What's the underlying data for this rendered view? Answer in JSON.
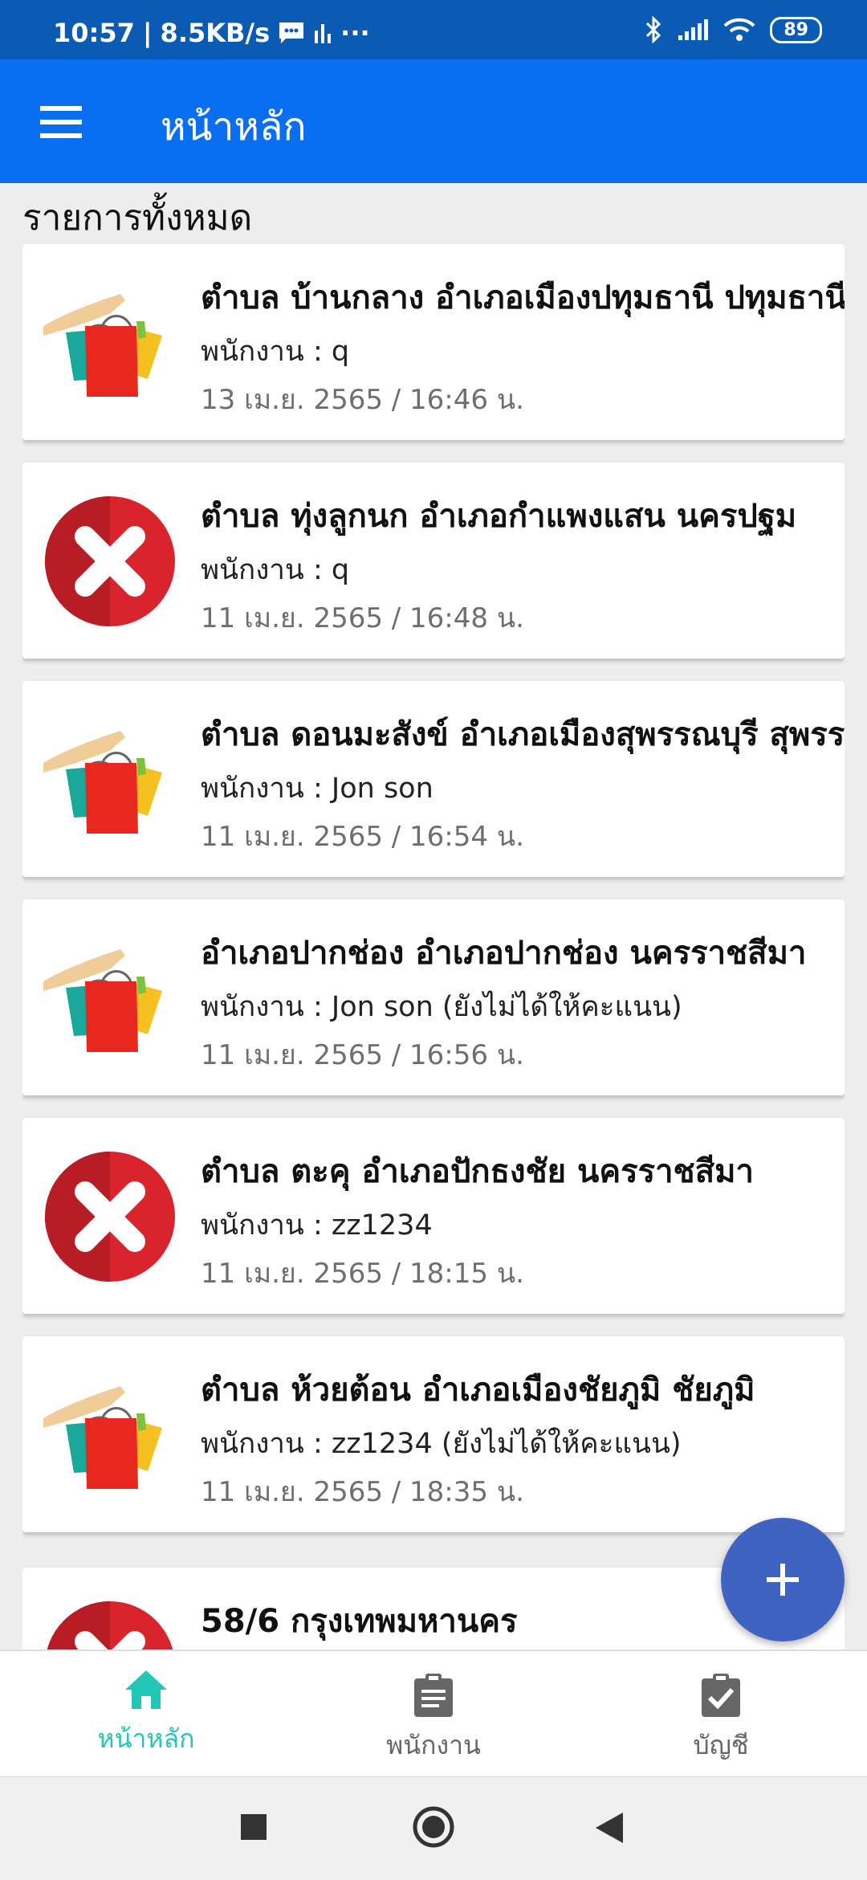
{
  "status_bar": {
    "time": "10:57",
    "speed": "8.5KB/s",
    "more": "···",
    "battery": "89"
  },
  "app_bar": {
    "title": "หน้าหลัก"
  },
  "section_title": "รายการทั้งหมด",
  "items": [
    {
      "title": "ตำบล บ้านกลาง อำเภอเมืองปทุมธานี ปทุมธานี",
      "staff": "พนักงาน : q",
      "date": "13 เม.ย. 2565 / 16:46 น.",
      "icon": "shopping-bags-icon"
    },
    {
      "title": "ตำบล ทุ่งลูกนก อำเภอกำแพงแสน นครปฐม",
      "staff": "พนักงาน : q",
      "date": "11 เม.ย. 2565 / 16:48 น.",
      "icon": "cancel-x-icon"
    },
    {
      "title": "ตำบล ดอนมะสังข์ อำเภอเมืองสุพรรณบุรี สุพรร",
      "staff": "พนักงาน : Jon son",
      "date": "11 เม.ย. 2565 / 16:54 น.",
      "icon": "shopping-bags-icon"
    },
    {
      "title": "อำเภอปากช่อง อำเภอปากช่อง นครราชสีมา",
      "staff": "พนักงาน : Jon son (ยังไม่ได้ให้คะแนน)",
      "date": "11 เม.ย. 2565 / 16:56 น.",
      "icon": "shopping-bags-icon"
    },
    {
      "title": "ตำบล ตะคุ อำเภอปักธงชัย นครราชสีมา",
      "staff": "พนักงาน : zz1234",
      "date": "11 เม.ย. 2565 / 18:15 น.",
      "icon": "cancel-x-icon"
    },
    {
      "title": "ตำบล ห้วยต้อน อำเภอเมืองชัยภูมิ ชัยภูมิ",
      "staff": "พนักงาน : zz1234 (ยังไม่ได้ให้คะแนน)",
      "date": "11 เม.ย. 2565 / 18:35 น.",
      "icon": "shopping-bags-icon"
    },
    {
      "title": "58/6   กรุงเทพมหานคร",
      "staff": "",
      "date": "",
      "icon": "cancel-x-icon"
    }
  ],
  "fab": {
    "icon": "plus-icon"
  },
  "bottom_nav": [
    {
      "label": "หน้าหลัก",
      "icon": "home-icon",
      "active": true
    },
    {
      "label": "พนักงาน",
      "icon": "clipboard-icon",
      "active": false
    },
    {
      "label": "บัญชี",
      "icon": "clipboard-check-icon",
      "active": false
    }
  ],
  "colors": {
    "status_bar": "#0b5bb5",
    "app_bar": "#0a6ef0",
    "fab": "#3f63c0",
    "nav_active": "#22c7b8",
    "nav_inactive": "#666666",
    "cancel_red": "#d9242e"
  }
}
